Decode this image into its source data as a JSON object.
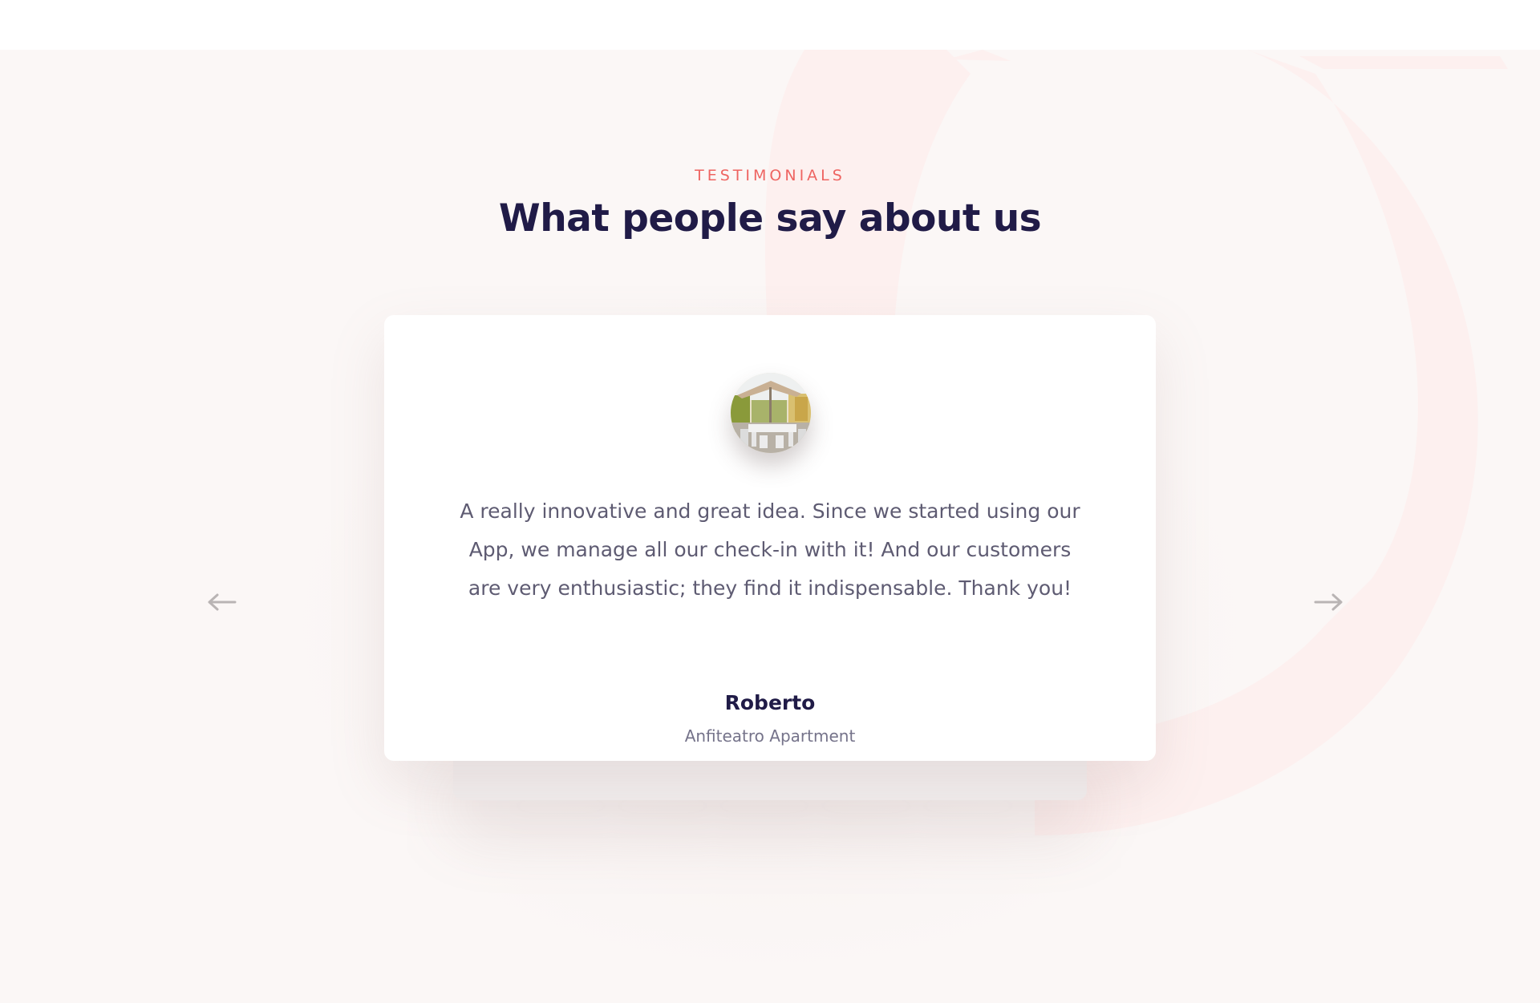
{
  "section": {
    "eyebrow": "TESTIMONIALS",
    "heading": "What people say about us"
  },
  "testimonial": {
    "avatar_alt": "Outdoor patio with umbrella and table",
    "quote": "A really innovative and great idea. Since we started using our App, we manage all our check-in with it! And our customers are very enthusiastic; they find it indispensable. Thank you!",
    "author": "Roberto",
    "company": "Anfiteatro Apartment"
  },
  "navigation": {
    "prev_icon": "arrow-left-icon",
    "next_icon": "arrow-right-icon"
  },
  "colors": {
    "accent": "#ee6461",
    "heading": "#201b47",
    "body_text": "#5e5b72",
    "background": "#fbf7f6",
    "arrow": "#b9b4b4"
  }
}
